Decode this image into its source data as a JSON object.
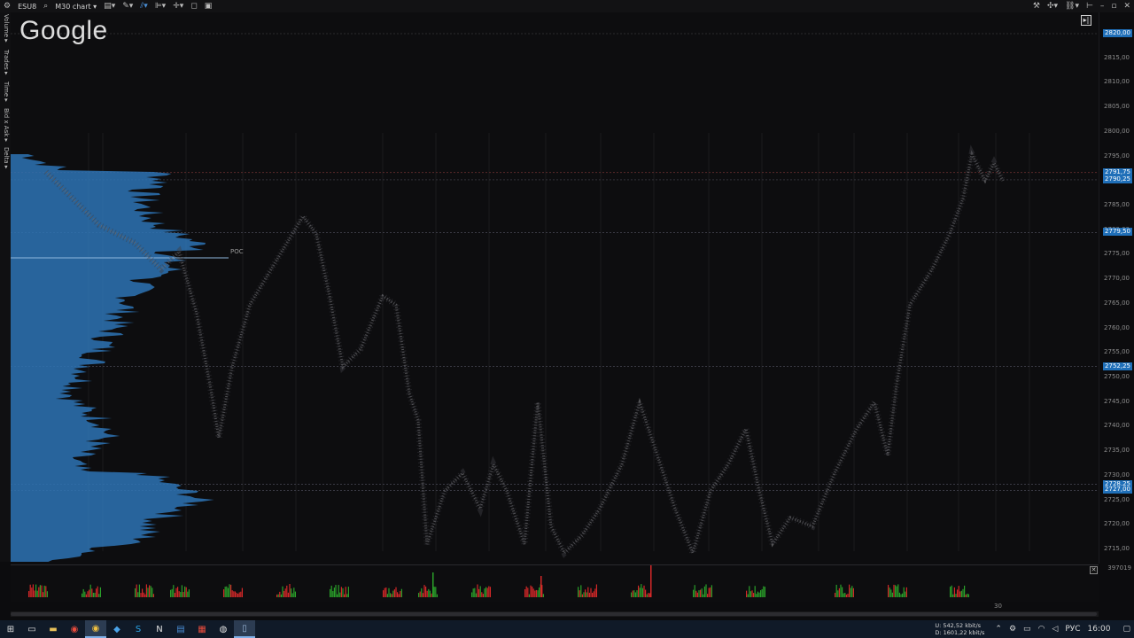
{
  "toolbar": {
    "symbol": "ESU8",
    "chart_menu": "M30 chart",
    "icons_left": [
      "search-icon",
      "layout-icon",
      "pencil-icon",
      "indicator-icon",
      "template-icon",
      "crosshair-icon",
      "window-icon",
      "save-icon"
    ],
    "icons_right": [
      "pin-icon",
      "tools-icon",
      "link-icon",
      "minimize-icon",
      "maximize-icon",
      "close-icon"
    ]
  },
  "left_tabs": [
    "Volume",
    "Trades",
    "Time",
    "Bid x Ask",
    "Delta"
  ],
  "chart": {
    "logo": "Google",
    "poc_label": "POC",
    "price_ticks": [
      "2820,00",
      "2815,00",
      "2810,00",
      "2805,00",
      "2800,00",
      "2795,00",
      "2790,00",
      "2785,00",
      "2780,00",
      "2775,00",
      "2770,00",
      "2765,00",
      "2760,00",
      "2755,00",
      "2750,00",
      "2745,00",
      "2740,00",
      "2735,00",
      "2730,00",
      "2725,00",
      "2720,00",
      "2715,00"
    ],
    "price_badges": [
      {
        "label": "2820,00",
        "price": 2820.0
      },
      {
        "label": "2791,75",
        "price": 2791.75
      },
      {
        "label": "2790,25",
        "price": 2790.25
      },
      {
        "label": "2779,50",
        "price": 2779.5
      },
      {
        "label": "2752,25",
        "price": 2752.25
      },
      {
        "label": "2728,25",
        "price": 2728.25
      },
      {
        "label": "2727,00",
        "price": 2727.0
      }
    ],
    "accent_color": "#1f6fb8",
    "profile_color": "#2e74b5"
  },
  "volume_pane": {
    "max_label": "397019",
    "up_color": "#2aa02a",
    "down_color": "#d42828"
  },
  "time_axis": {
    "label": "30"
  },
  "taskbar": {
    "icons": [
      "windows-start-icon",
      "task-view-icon",
      "file-explorer-icon",
      "chrome-icon",
      "browser-icon",
      "app-icon",
      "skype-icon",
      "notes-icon",
      "mail-icon",
      "media-icon",
      "app-icon-2",
      "document-icon"
    ],
    "net_up": "U:      542,52 kbit/s",
    "net_down": "D:    1601,22 kbit/s",
    "lang": "РУС",
    "time": "16:00"
  }
}
